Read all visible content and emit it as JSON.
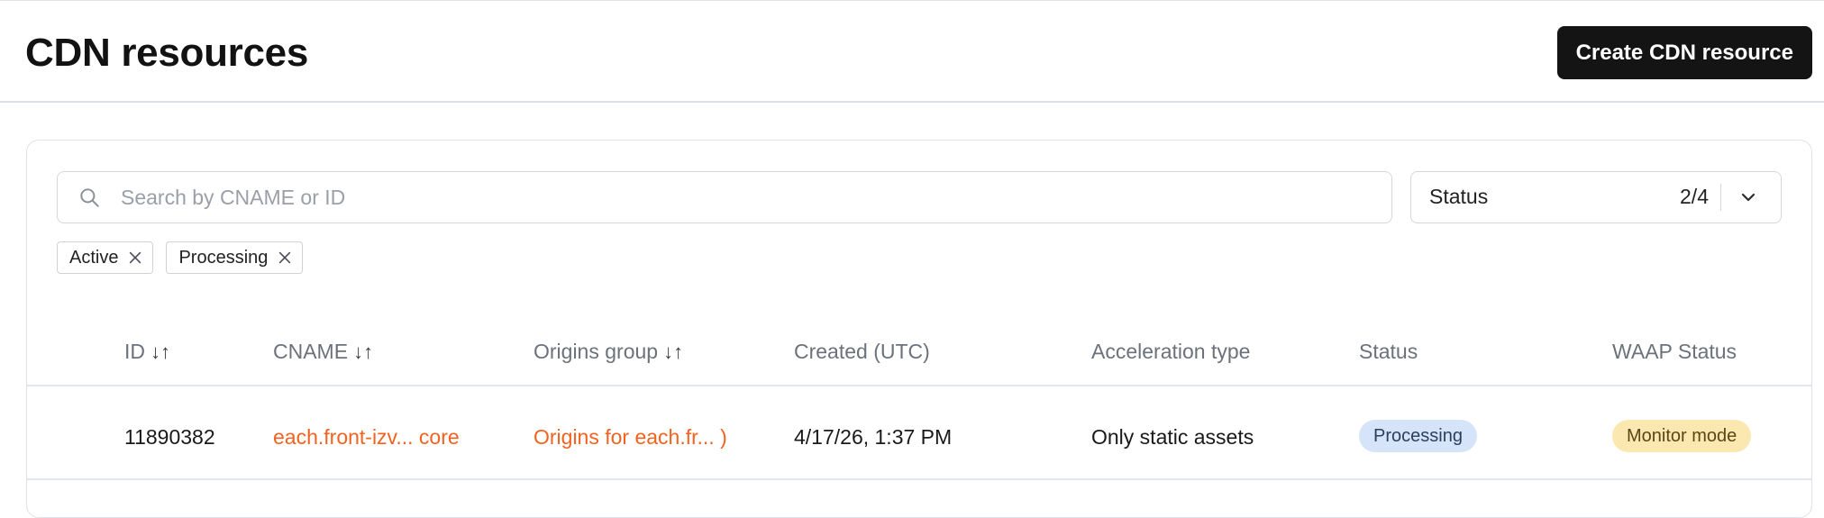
{
  "header": {
    "title": "CDN resources",
    "create_button_label": "Create CDN resource"
  },
  "search": {
    "placeholder": "Search by CNAME or ID",
    "value": ""
  },
  "status_filter": {
    "label": "Status",
    "count": "2/4"
  },
  "chips": [
    {
      "label": "Active"
    },
    {
      "label": "Processing"
    }
  ],
  "table": {
    "columns": [
      {
        "label": "ID",
        "sort": "↓↑"
      },
      {
        "label": "CNAME",
        "sort": "↓↑"
      },
      {
        "label": "Origins group",
        "sort": "↓↑"
      },
      {
        "label": "Created (UTC)"
      },
      {
        "label": "Acceleration type"
      },
      {
        "label": "Status"
      },
      {
        "label": "WAAP Status"
      }
    ],
    "rows": [
      {
        "id": "11890382",
        "cname": "each.front-izv... core",
        "origins_group": "Origins for each.fr... )",
        "created": "4/17/26, 1:37 PM",
        "acceleration": "Only static assets",
        "status": "Processing",
        "waap_status": "Monitor mode"
      }
    ]
  },
  "colors": {
    "accent_link": "#f4621f",
    "primary_button": "#141414",
    "status_processing_bg": "#d6e4fa",
    "waap_monitor_bg": "#fbe7b0"
  }
}
